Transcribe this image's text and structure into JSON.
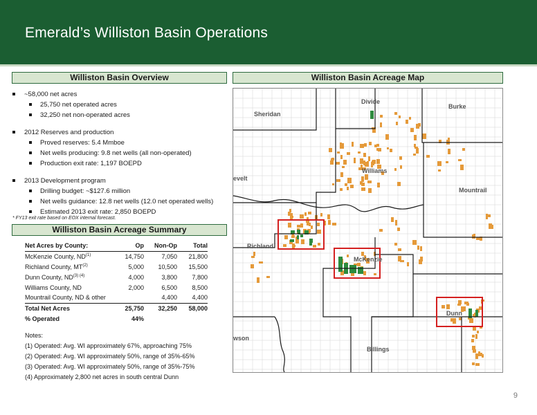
{
  "header": {
    "title": "Emerald’s Williston Basin Operations"
  },
  "overview": {
    "title": "Williston Basin Overview",
    "items": [
      {
        "level": 1,
        "text": "~58,000 net acres"
      },
      {
        "level": 2,
        "text": "25,750 net operated acres"
      },
      {
        "level": 2,
        "text": "32,250 net non-operated acres"
      },
      {
        "level": 0
      },
      {
        "level": 1,
        "text": "2012 Reserves and production"
      },
      {
        "level": 2,
        "text": "Proved reserves: 5.4 Mmboe"
      },
      {
        "level": 2,
        "text": "Net wells producing: 9.8 net wells (all non-operated)"
      },
      {
        "level": 2,
        "text": "Production exit rate: 1,197 BOEPD"
      },
      {
        "level": 0
      },
      {
        "level": 1,
        "text": "2013 Development program"
      },
      {
        "level": 2,
        "text": "Drilling budget: ~$127.6 million"
      },
      {
        "level": 2,
        "text": "Net wells guidance: 12.8 net wells (12.0 net operated wells)"
      },
      {
        "level": 2,
        "text": "Estimated 2013 exit rate: 2,850 BOEPD"
      }
    ],
    "footnote": "* FY13 exit rate based on EOX internal forecast."
  },
  "summary": {
    "title": "Williston Basin Acreage Summary",
    "columns": [
      "Net Acres by County:",
      "Op",
      "Non-Op",
      "Total"
    ],
    "rows": [
      {
        "county": "McKenzie County, ND",
        "sup": "(1)",
        "op": "14,750",
        "nonop": "7,050",
        "total": "21,800"
      },
      {
        "county": "Richland County, MT",
        "sup": "(2)",
        "op": "5,000",
        "nonop": "10,500",
        "total": "15,500"
      },
      {
        "county": "Dunn County, ND",
        "sup": "(3) (4)",
        "op": "4,000",
        "nonop": "3,800",
        "total": "7,800"
      },
      {
        "county": "Williams County, ND",
        "sup": "",
        "op": "2,000",
        "nonop": "6,500",
        "total": "8,500"
      },
      {
        "county": "Mountrail County, ND & other",
        "sup": "",
        "op": "",
        "nonop": "4,400",
        "total": "4,400"
      }
    ],
    "total": {
      "label": "Total Net Acres",
      "op": "25,750",
      "nonop": "32,250",
      "total": "58,000"
    },
    "pct": {
      "label": "% Operated",
      "value": "44%"
    }
  },
  "notes": {
    "title": "Notes:",
    "lines": [
      "(1) Operated: Avg. WI approximately 67%, approaching 75%",
      "(2) Operated: Avg. WI approximately 50%, range of 35%-65%",
      "(3) Operated: Avg. WI approximately 50%, range of 35%-75%",
      "(4) Approximately 2,800 net acres in south central Dunn"
    ]
  },
  "map": {
    "title": "Williston Basin Acreage Map",
    "labels": {
      "divide": "Divide",
      "burke": "Burke",
      "sheridan": "Sheridan",
      "williams": "Williams",
      "roosevelt": "evelt",
      "mountrail": "Mountrail",
      "richland": "Richland",
      "mckenzie": "McKenzie",
      "dunn": "Dunn",
      "dawson": "wson",
      "billings": "Billings"
    },
    "colors": {
      "operated": "#2e8b3e",
      "non_operated": "#e59a3a",
      "highlight": "#d42020",
      "county_line": "#1a1a1a",
      "grid": "#d4d4d4"
    }
  },
  "page_number": "9"
}
